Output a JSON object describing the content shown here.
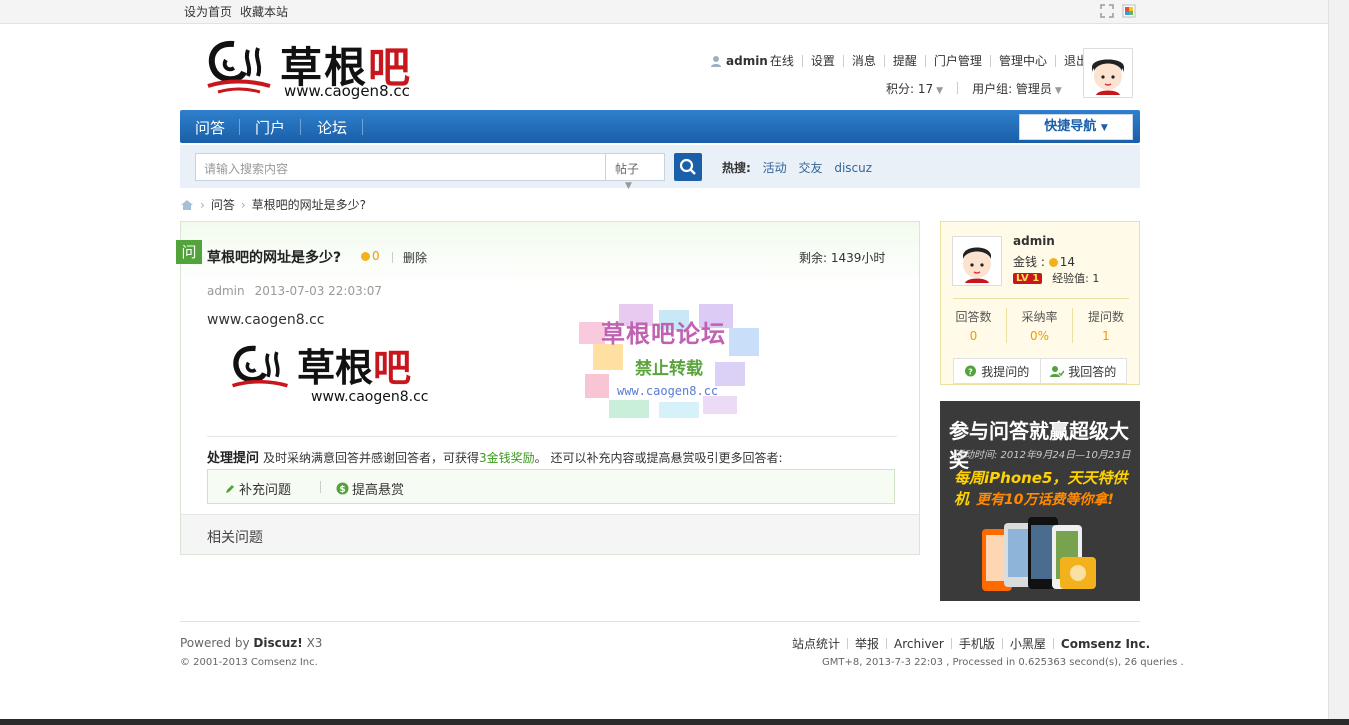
{
  "topbar": {
    "set_home": "设为首页",
    "bookmark": "收藏本站"
  },
  "header": {
    "logo_cn_black": "草根",
    "logo_cn_red": "吧",
    "logo_url": "www.caogen8.cc",
    "user": "admin",
    "online": "在线",
    "nav_links": [
      "设置",
      "消息",
      "提醒",
      "门户管理",
      "管理中心",
      "退出"
    ],
    "points": "积分: 17",
    "usergroup": "用户组: 管理员"
  },
  "nav": {
    "items": [
      "问答",
      "门户",
      "论坛"
    ],
    "quick_nav": "快捷导航"
  },
  "search": {
    "placeholder": "请输入搜索内容",
    "type": "帖子",
    "hot_label": "热搜:",
    "hot_items": [
      "活动",
      "交友",
      "discuz"
    ]
  },
  "breadcrumb": {
    "items": [
      "问答",
      "草根吧的网址是多少?"
    ]
  },
  "question": {
    "badge": "问",
    "title": "草根吧的网址是多少?",
    "reward": "0",
    "delete": "删除",
    "remaining": "剩余: 1439小时",
    "author": "admin",
    "date": "2013-07-03 22:03:07",
    "body": "www.caogen8.cc",
    "img_cn_black": "草根",
    "img_cn_red": "吧",
    "img_url": "www.caogen8.cc",
    "handle_title": "处理提问",
    "handle_text_1": "及时采纳满意回答并感谢回答者，可获得",
    "handle_text_green": "3金钱奖励",
    "handle_text_2": "。 还可以补充内容或提高悬赏吸引更多回答者:",
    "add_question": "补充问题",
    "raise_reward": "提高悬赏",
    "related": "相关问题"
  },
  "watermark": {
    "line1": "草根吧论坛",
    "line2": "禁止转载",
    "line3": "www.caogen8.cc"
  },
  "sidebar": {
    "username": "admin",
    "money_label": "金钱 :",
    "money_value": "14",
    "level": "LV 1",
    "exp": "经验值: 1",
    "stats": [
      {
        "label": "回答数",
        "value": "0"
      },
      {
        "label": "采纳率",
        "value": "0%"
      },
      {
        "label": "提问数",
        "value": "1"
      }
    ],
    "my_questions": "我提问的",
    "my_answers": "我回答的"
  },
  "ad": {
    "title": "参与问答就赢超级大奖",
    "date": "活动时间: 2012年9月24日—10月23日",
    "line1": "每周iPhone5，天天特供机",
    "line2": "更有10万话费等你拿!"
  },
  "footer": {
    "powered_prefix": "Powered by",
    "powered_name": "Discuz!",
    "powered_ver": "X3",
    "copyright": "© 2001-2013 Comsenz Inc.",
    "links": [
      "站点统计",
      "举报",
      "Archiver",
      "手机版",
      "小黑屋"
    ],
    "company": "Comsenz Inc.",
    "info": "GMT+8, 2013-7-3 22:03 , Processed in 0.625363 second(s), 26 queries ."
  },
  "colors": {
    "nav_blue": "#1a5fa8",
    "green": "#52a33b",
    "orange": "#f39800",
    "logo_red": "#c8161d"
  }
}
